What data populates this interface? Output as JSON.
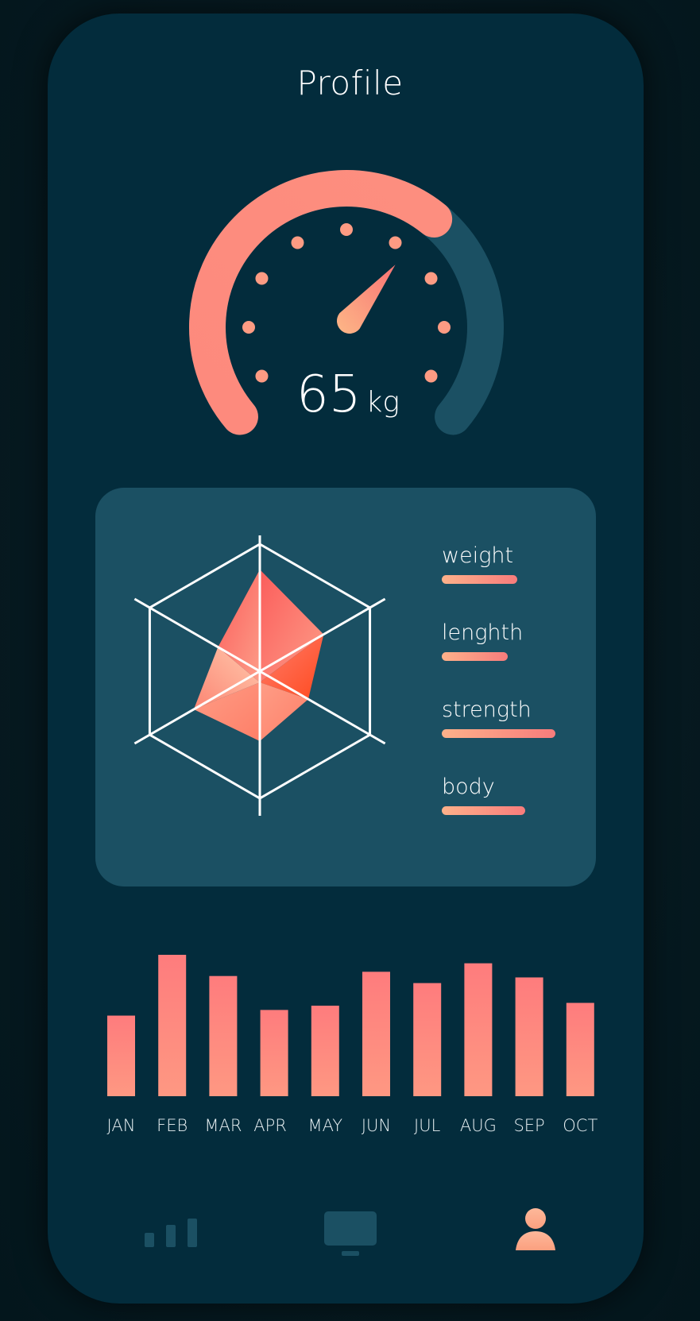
{
  "header": {
    "title": "Profile"
  },
  "gauge": {
    "value": "65",
    "unit": "kg",
    "fraction": 0.65
  },
  "stats": {
    "items": [
      {
        "label": "weight",
        "level": 0.56
      },
      {
        "label": "lenghth",
        "level": 0.49
      },
      {
        "label": "strength",
        "level": 0.84
      },
      {
        "label": "body",
        "level": 0.62
      }
    ]
  },
  "radar": {
    "axes": 6,
    "values": [
      0.8,
      0.58,
      0.44,
      0.55,
      0.6,
      0.38
    ]
  },
  "chart_data": {
    "type": "bar",
    "categories": [
      "JAN",
      "FEB",
      "MAR",
      "APR",
      "MAY",
      "JUN",
      "JUL",
      "AUG",
      "SEP",
      "OCT"
    ],
    "values": [
      0.57,
      1.0,
      0.85,
      0.61,
      0.64,
      0.88,
      0.8,
      0.94,
      0.84,
      0.66
    ],
    "title": "",
    "xlabel": "",
    "ylabel": "",
    "ylim": [
      0,
      1
    ]
  },
  "tabbar": {
    "tabs": [
      {
        "icon": "bar-chart-icon",
        "active": false
      },
      {
        "icon": "monitor-icon",
        "active": false
      },
      {
        "icon": "user-icon",
        "active": true
      }
    ]
  },
  "colors": {
    "background": "#032c3c",
    "card": "#1b5063",
    "accent_start": "#fdb18a",
    "accent_end": "#f87c7c",
    "inactive": "#1b5063"
  }
}
